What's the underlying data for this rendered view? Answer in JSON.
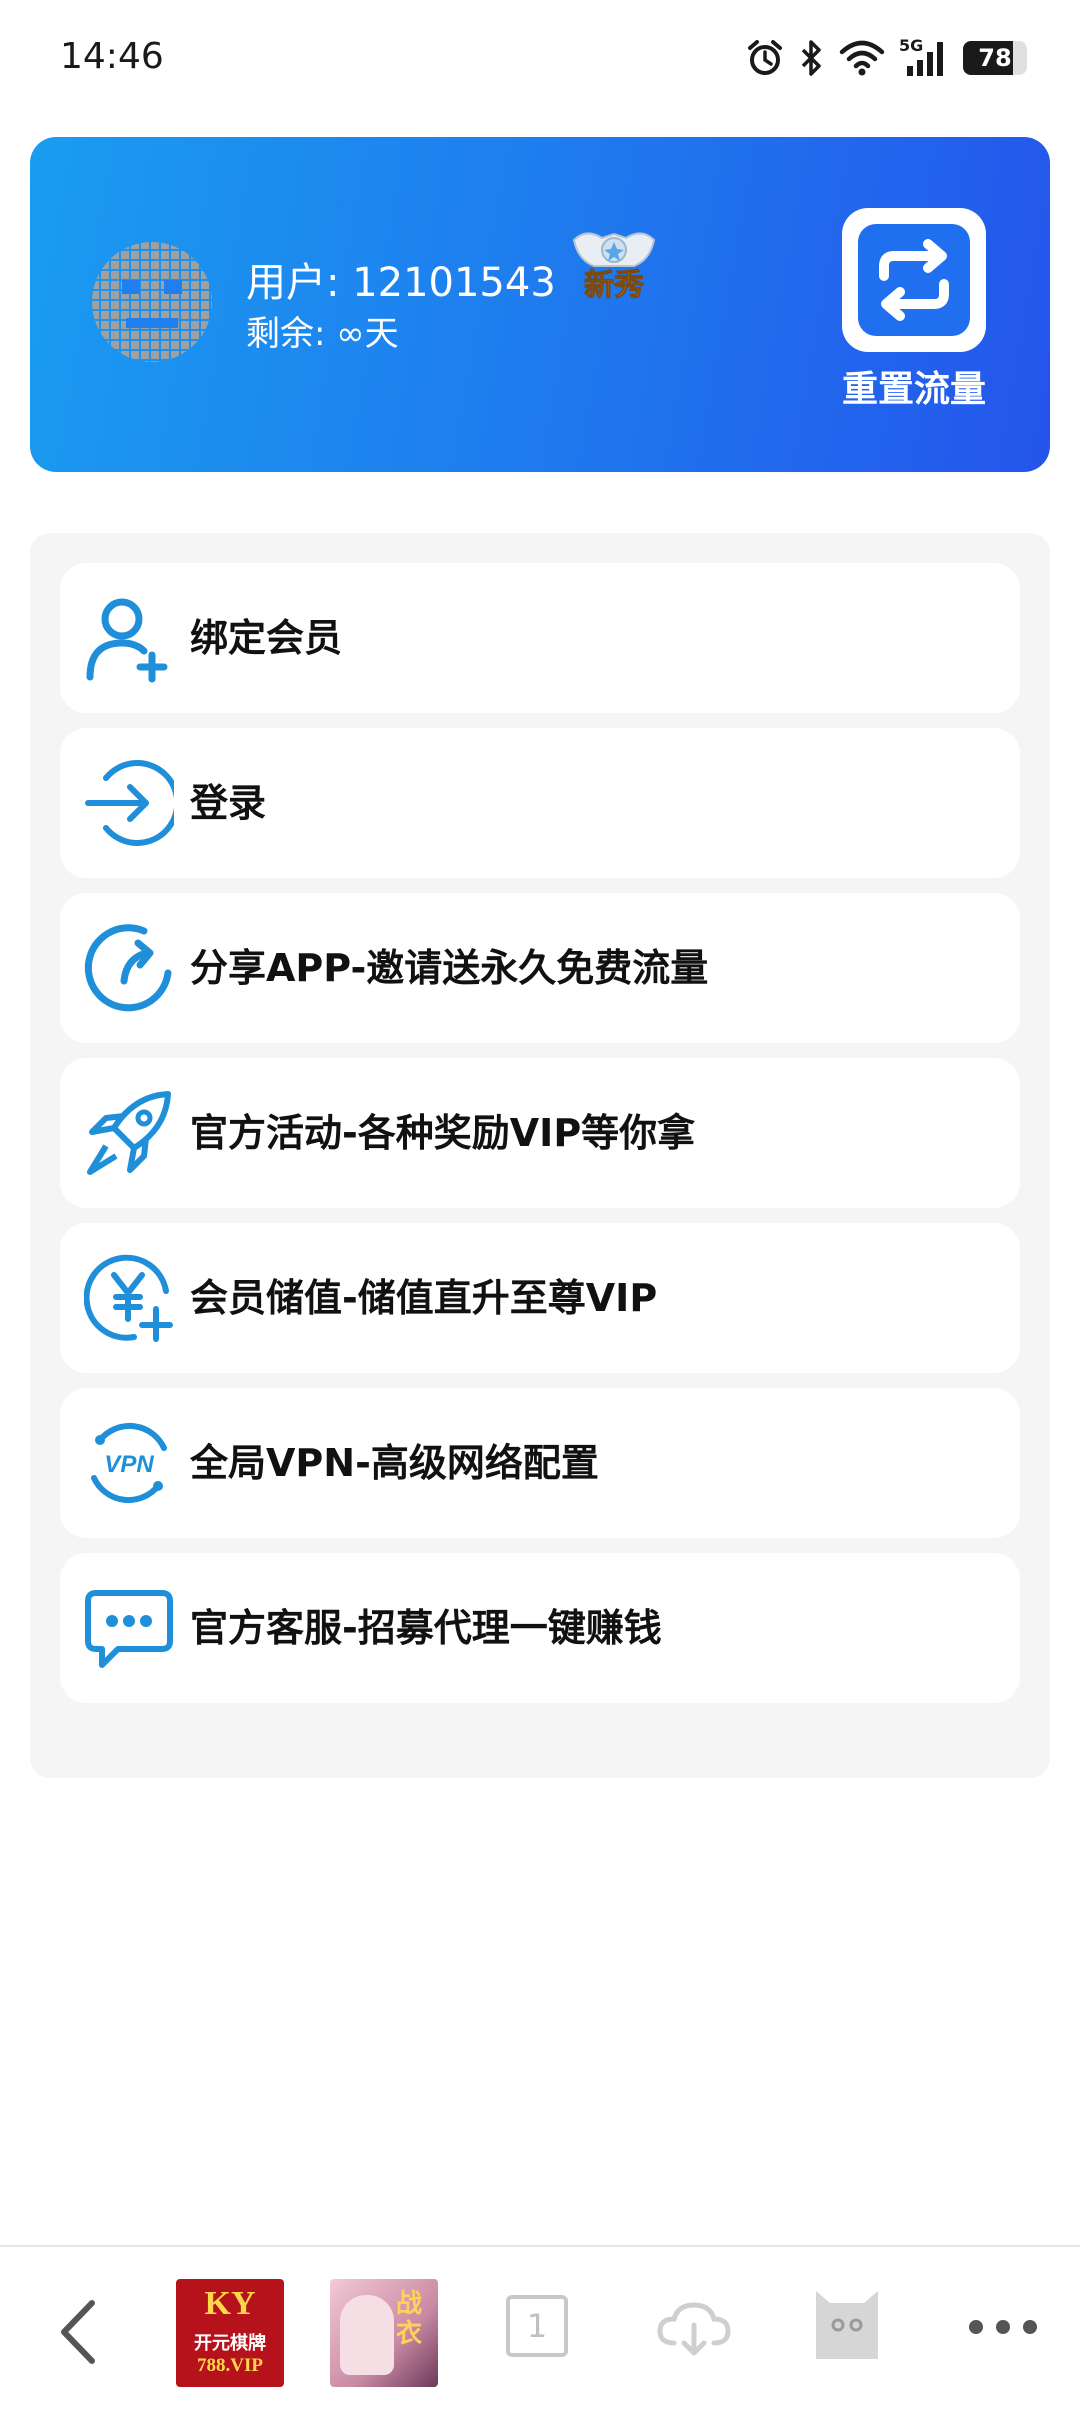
{
  "status_bar": {
    "time": "14:46",
    "network": "5G",
    "battery_level": 78,
    "battery_label": "78"
  },
  "header": {
    "user_label": "用户: 12101543",
    "remaining_label": "剩余: ∞天",
    "badge_text": "新秀",
    "reset_button_label": "重置流量",
    "gradient_start": "#1a9cf0",
    "gradient_end": "#2455ec"
  },
  "menu": {
    "accent_color": "#1e8fd8",
    "items": [
      {
        "label": "绑定会员",
        "icon": "add-user-icon"
      },
      {
        "label": "登录",
        "icon": "login-arrow-icon"
      },
      {
        "label": "分享APP-邀请送永久免费流量",
        "icon": "share-refresh-icon"
      },
      {
        "label": "官方活动-各种奖励VIP等你拿",
        "icon": "rocket-icon"
      },
      {
        "label": "会员储值-储值直升至尊VIP",
        "icon": "yuan-plus-icon"
      },
      {
        "label": "全局VPN-高级网络配置",
        "icon": "vpn-icon"
      },
      {
        "label": "官方客服-招募代理一键赚钱",
        "icon": "chat-bubble-icon"
      }
    ]
  },
  "bottom_bar": {
    "tab_count": "1",
    "ad1_text_top": "KY",
    "ad1_text_mid": "开元棋牌",
    "ad1_text_bottom": "788.VIP",
    "ad2_text": "战衣"
  }
}
